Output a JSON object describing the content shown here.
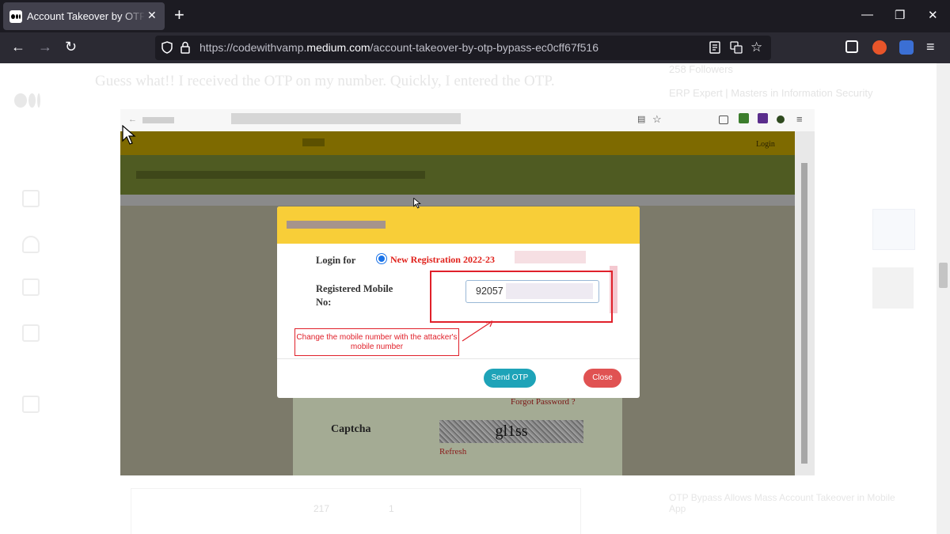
{
  "browser": {
    "tab_title": "Account Takeover by OTP bypass",
    "tab_close": "✕",
    "new_tab": "+",
    "url_prefix": "https://codewithvamp.",
    "url_host": "medium.com",
    "url_path": "/account-takeover-by-otp-bypass-ec0cff67f516"
  },
  "page": {
    "ghost_line": "Guess what!! I received the OTP on my number. Quickly, I entered the OTP.",
    "ghost_followers": "258 Followers",
    "ghost_bio": "ERP Expert | Masters in Information Security",
    "ghost_bottom": "OTP Bypass Allows Mass Account Takeover in Mobile App",
    "ghost_claps": "217",
    "ghost_comments": "1"
  },
  "shot": {
    "header_login": "Login",
    "modal": {
      "login_for_label": "Login for",
      "login_for_option": "New Registration 2022-23",
      "mobile_label_line1": "Registered Mobile",
      "mobile_label_line2": "No:",
      "mobile_value": "92057",
      "annotation": "Change the mobile number with the attacker's mobile number",
      "send_otp": "Send OTP",
      "close": "Close"
    },
    "form": {
      "forgot": "Forgot Password ?",
      "captcha_label": "Captcha",
      "captcha_text": "gl1ss",
      "refresh": "Refresh"
    }
  },
  "colors": {
    "modal_header": "#f8ce38",
    "send_otp": "#1ea3b8",
    "close": "#e05252",
    "annotation_red": "#e0202a"
  }
}
